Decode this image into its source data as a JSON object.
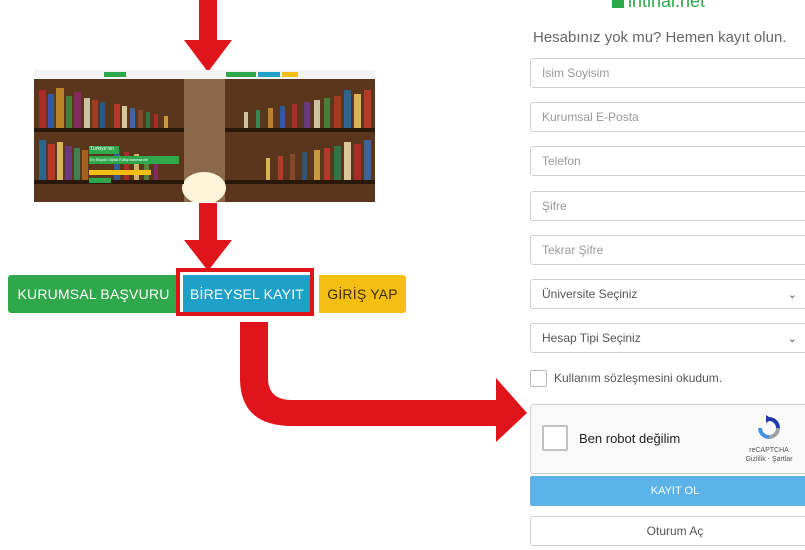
{
  "brand": {
    "logo_text": "intihal.net"
  },
  "left_panel": {
    "hero_tagline_1": "Türkiye'nin",
    "hero_tagline_2": "En Büyük Dijital Kütüphanesinde",
    "buttons": {
      "kurumsal": "KURUMSAL BAŞVURU",
      "bireysel": "BİREYSEL KAYIT",
      "giris": "GİRİŞ YAP"
    }
  },
  "form": {
    "subtitle": "Hesabınız yok mu? Hemen kayıt olun.",
    "fields": {
      "name": "İsim Soyisim",
      "email": "Kurumsal E-Posta",
      "phone": "Telefon",
      "password": "Şifre",
      "password_repeat": "Tekrar Şifre"
    },
    "university_select": "Üniversite Seçiniz",
    "account_type_select": "Hesap Tipi Seçiniz",
    "terms_checkbox": "Kullanım sözleşmesini okudum.",
    "recaptcha": {
      "label": "Ben robot değilim",
      "brand": "reCAPTCHA",
      "links": "Gizlilik - Şartlar"
    },
    "register_button": "KAYIT OL",
    "login_button": "Oturum Aç"
  },
  "colors": {
    "arrow": "#e0151b",
    "green": "#2ea84a",
    "teal": "#1fa0c8",
    "yellow": "#f5be12",
    "register_blue": "#5bb3ea"
  }
}
